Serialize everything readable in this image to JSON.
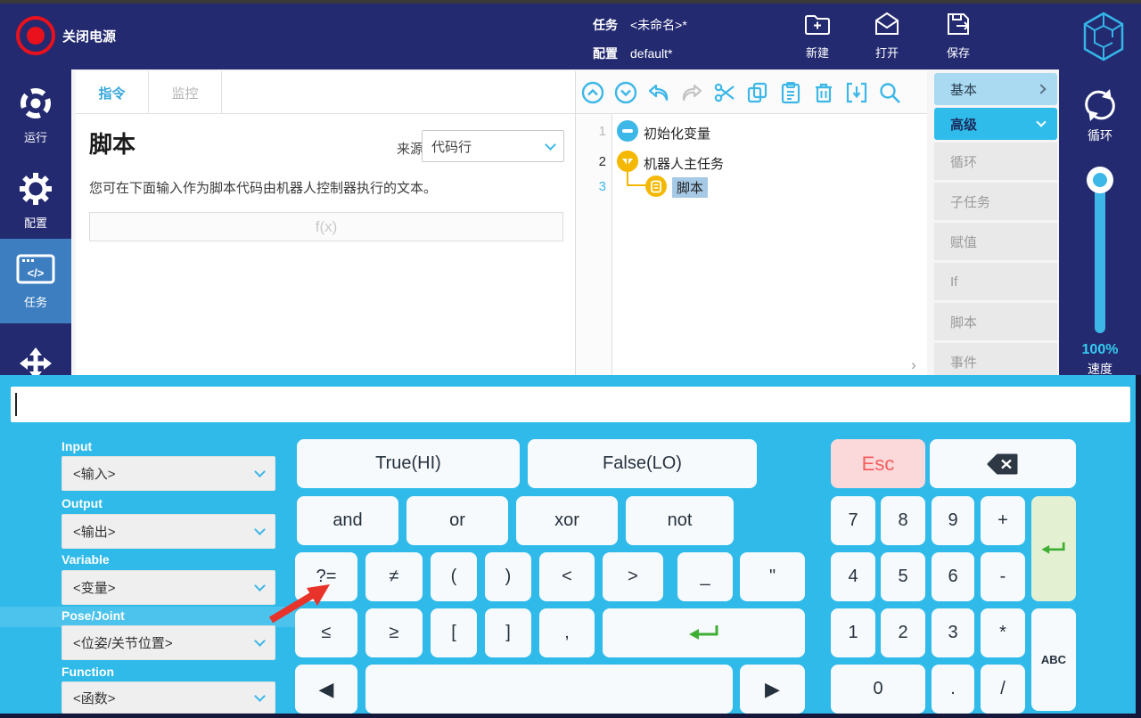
{
  "topbar": {
    "power_label": "关闭电源",
    "task_label": "任务",
    "task_value": "<未命名>*",
    "config_label": "配置",
    "config_value": "default*",
    "actions": [
      {
        "label": "新建"
      },
      {
        "label": "打开"
      },
      {
        "label": "保存"
      }
    ]
  },
  "sidebar": {
    "items": [
      {
        "label": "运行"
      },
      {
        "label": "配置"
      },
      {
        "label": "任务"
      }
    ]
  },
  "main": {
    "tabs": [
      {
        "label": "指令"
      },
      {
        "label": "监控"
      }
    ],
    "title": "脚本",
    "source_label": "来源",
    "source_value": "代码行",
    "description": "您可在下面输入作为脚本代码由机器人控制器执行的文本。",
    "input_placeholder": "f(x)"
  },
  "tree": {
    "rows": [
      {
        "num": "1",
        "label": "初始化变量"
      },
      {
        "num": "2",
        "label": "机器人主任务"
      },
      {
        "num": "3",
        "label": "脚本"
      }
    ]
  },
  "palette": {
    "basic_label": "基本",
    "advanced_label": "高级",
    "items": [
      "循环",
      "子任务",
      "赋值",
      "If",
      "脚本",
      "事件"
    ]
  },
  "rightbar": {
    "loop_label": "循环",
    "speed_value": "100%",
    "speed_label": "速度"
  },
  "keyboard": {
    "input_value": "",
    "selectors": [
      {
        "label": "Input",
        "value": "<输入>"
      },
      {
        "label": "Output",
        "value": "<输出>"
      },
      {
        "label": "Variable",
        "value": "<变量>"
      },
      {
        "label": "Pose/Joint",
        "value": "<位姿/关节位置>"
      },
      {
        "label": "Function",
        "value": "<函数>"
      }
    ],
    "rows": [
      [
        "True(HI)",
        "False(LO)"
      ],
      [
        "and",
        "or",
        "xor",
        "not"
      ],
      [
        "?=",
        "≠",
        "(",
        ")",
        "<",
        ">",
        "_",
        "\""
      ],
      [
        "≤",
        "≥",
        "[",
        "]",
        ","
      ]
    ],
    "nav": {
      "left": "◀",
      "right": "▶"
    },
    "numpad": {
      "esc": "Esc",
      "rows": [
        [
          "7",
          "8",
          "9",
          "+"
        ],
        [
          "4",
          "5",
          "6",
          "-"
        ],
        [
          "1",
          "2",
          "3",
          "*"
        ]
      ],
      "bottom": [
        "0",
        ".",
        "/"
      ],
      "abc": "ABC"
    }
  },
  "colors": {
    "accent_cyan": "#2fbae9",
    "navy": "#232a70",
    "sidebar_active": "#3c7ec0",
    "key_bg": "#f7fafc",
    "key_text": "#26313e",
    "esc_bg": "#fbd9da",
    "esc_text": "#f25e5e",
    "enter_bg": "#e3f1d2",
    "enter_green": "#3fae34",
    "tree_yellow": "#f5b800",
    "selection_blue": "#a6c9e6",
    "palette_basic_bg": "#a9daf1",
    "palette_advanced_bg": "#2fbcea",
    "disabled_gray": "#c4c4c4",
    "power_red": "#e8111c",
    "arrow_red": "#e8332a"
  }
}
